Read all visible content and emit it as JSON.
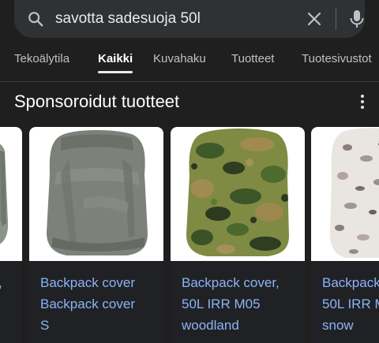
{
  "search": {
    "query": "savotta sadesuoja 50l",
    "icons": {
      "search": "search-icon",
      "clear": "close-icon",
      "voice": "mic-icon"
    }
  },
  "tabs": [
    {
      "label": "Tekoälytila",
      "active": false
    },
    {
      "label": "Kaikki",
      "active": true
    },
    {
      "label": "Kuvahaku",
      "active": false
    },
    {
      "label": "Tuotteet",
      "active": false
    },
    {
      "label": "Tuotesivustot",
      "active": false
    }
  ],
  "section": {
    "title": "Sponsoroidut tuotteet",
    "more_icon": "more-vert-icon"
  },
  "products": [
    {
      "title": ",",
      "image": "grey-green backpack cover (partial)"
    },
    {
      "title": "Backpack cover\nBackpack cover\nS",
      "image": "grey backpack rain cover"
    },
    {
      "title": "Backpack cover,\n50L IRR M05\nwoodland",
      "image": "woodland camo backpack cover"
    },
    {
      "title": "Backpack\n50L IRR M\nsnow",
      "image": "snow camo backpack cover (partial)"
    }
  ],
  "colors": {
    "background": "#1f1f1f",
    "searchbar": "#303134",
    "link": "#8ab4f8",
    "tab_active": "#ffffff",
    "tab_inactive": "#bdc1c6"
  }
}
